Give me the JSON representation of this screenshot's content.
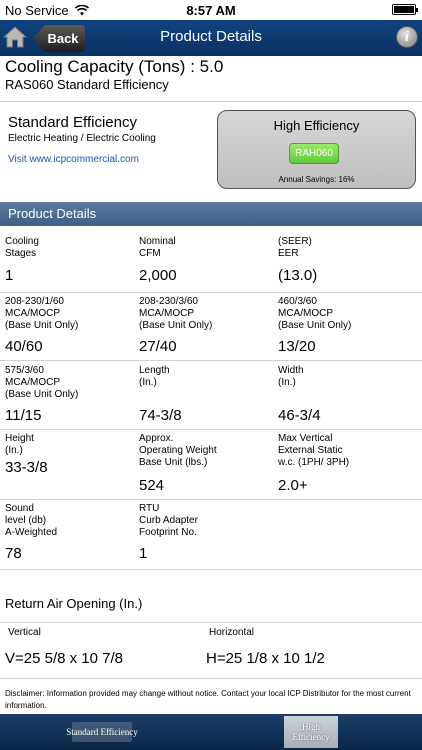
{
  "status": {
    "carrier": "No Service",
    "time": "8:57 AM"
  },
  "nav": {
    "back_label": "Back",
    "title": "Product Details"
  },
  "header": {
    "capacity": "Cooling Capacity (Tons) : 5.0",
    "model": "RAS060 Standard Efficiency"
  },
  "standard": {
    "title": "Standard Efficiency",
    "subtitle": "Electric Heating / Electric Cooling",
    "link": "Visit www.icpcommercial.com"
  },
  "high_efficiency": {
    "title": "High Efficiency",
    "model": "RAH060",
    "savings": "Annual Savings: 16%"
  },
  "section_title": "Product Details",
  "details": [
    [
      {
        "label": "Cooling\nStages",
        "value": "1"
      },
      {
        "label": "Nominal\nCFM",
        "value": "2,000"
      },
      {
        "label": "(SEER)\nEER",
        "value": "(13.0)"
      }
    ],
    [
      {
        "label": "208-230/1/60\nMCA/MOCP\n(Base Unit Only)",
        "value": "40/60"
      },
      {
        "label": "208-230/3/60\nMCA/MOCP\n(Base Unit Only)",
        "value": "27/40"
      },
      {
        "label": "460/3/60\nMCA/MOCP\n(Base Unit Only)",
        "value": "13/20"
      }
    ],
    [
      {
        "label": "575/3/60\nMCA/MOCP\n(Base Unit Only)",
        "value": "11/15"
      },
      {
        "label": "Length\n(In.)",
        "value": "74-3/8"
      },
      {
        "label": "Width\n(In.)",
        "value": "46-3/4"
      }
    ],
    [
      {
        "label": "Height\n(In.)",
        "value": "33-3/8"
      },
      {
        "label": "Approx.\nOperating Weight\nBase Unit (lbs.)",
        "value": "524"
      },
      {
        "label": "Max Vertical\nExternal Static\nw.c. (1PH/ 3PH)",
        "value": "2.0+"
      }
    ],
    [
      {
        "label": "Sound\nlevel (db)\nA-Weighted",
        "value": "78"
      },
      {
        "label": "RTU\nCurb Adapter\nFootprint No.",
        "value": "1"
      },
      {
        "label": "",
        "value": ""
      }
    ]
  ],
  "return_air": {
    "title": "Return Air Opening (In.)",
    "vertical_label": "Vertical",
    "vertical_value": "V=25 5/8 x 10 7/8",
    "horizontal_label": "Horizontal",
    "horizontal_value": "H=25 1/8 x 10 1/2"
  },
  "disclaimer": "Disclaimer: Information provided may change without notice. Contact your local ICP Distributor for the most current information.",
  "tabs": {
    "standard": "Standard Efficiency",
    "high": "High Efficiency"
  },
  "colors": {
    "nav": "#0d3a72",
    "section": "#4a6b92",
    "pill": "#7dd64f",
    "link": "#1a55c0"
  }
}
